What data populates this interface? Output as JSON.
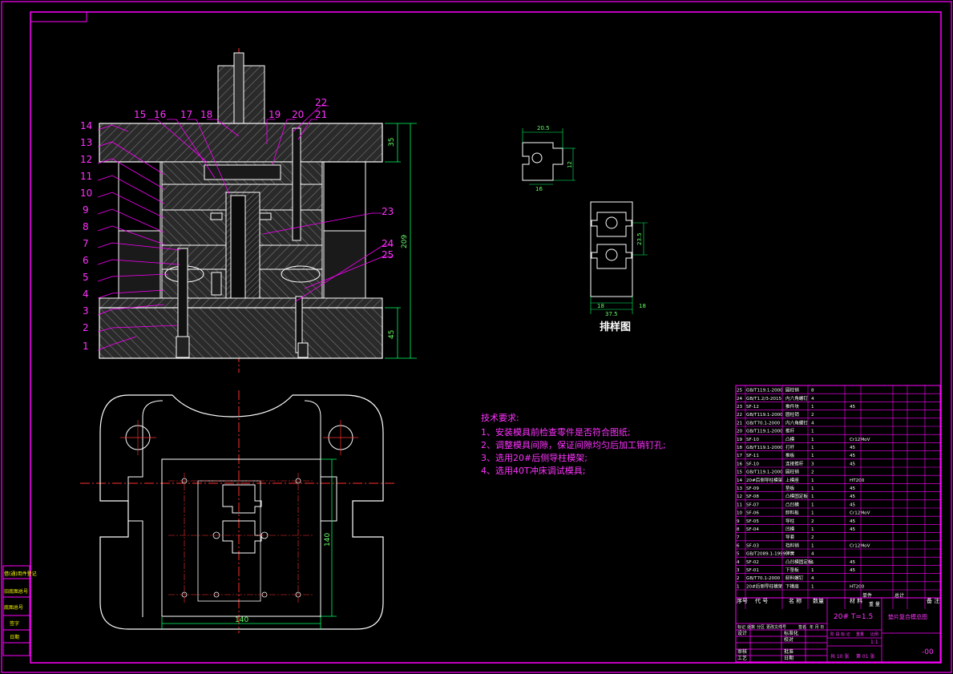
{
  "colors": {
    "border": "#ff00ff",
    "outline": "#ffffff",
    "section_fill": "#3a3a3a",
    "centerline": "#ff3030",
    "leader": "#ff00ff",
    "dimension": "#00ff66",
    "magenta_text": "#ff33ff",
    "dim_text": "#66ff66",
    "yellow": "#ffff00"
  },
  "part_numbers": [
    "1",
    "2",
    "3",
    "4",
    "5",
    "6",
    "7",
    "8",
    "9",
    "10",
    "11",
    "12",
    "13",
    "14",
    "15",
    "16",
    "17",
    "18",
    "19",
    "20",
    "21",
    "22",
    "23",
    "24",
    "25"
  ],
  "front_view": {
    "dimensions": {
      "top_plate": "35",
      "total_height": "209",
      "bottom_plate": "45"
    }
  },
  "top_view": {
    "dimensions": {
      "width": "140",
      "height": "140"
    }
  },
  "blank_layout": {
    "caption": "排样图",
    "dimensions": {
      "pitch": "23.5",
      "strip_width": "37.5",
      "margin_left": "18",
      "margin_right": "18"
    }
  },
  "part_drawing": {
    "dimensions": {
      "top": "20.5",
      "side": "12",
      "bottom": "16"
    }
  },
  "tech_requirements": {
    "title": "技术要求:",
    "items": [
      "1、安装模具前检查零件是否符合图纸;",
      "2、调整模具间隙，保证间隙均匀后加工销钉孔;",
      "3、选用20#后侧导柱模架;",
      "4、选用40T冲床调试模具;"
    ]
  },
  "bom": {
    "header": {
      "seq": "序号",
      "code": "代 号",
      "name": "名 称",
      "qty": "数量",
      "material": "材 料",
      "unit_weight": "单件",
      "total_weight": "总计",
      "weight": "重 量",
      "remark": "备 注"
    },
    "rows": [
      {
        "seq": "25",
        "code": "GB/T119.1-2000",
        "name": "圆柱销",
        "qty": "8",
        "material": ""
      },
      {
        "seq": "24",
        "code": "GB/T1.2/3-2015",
        "name": "内六角螺钉",
        "qty": "4",
        "material": ""
      },
      {
        "seq": "23",
        "code": "SF-12",
        "name": "推件块",
        "qty": "1",
        "material": "45"
      },
      {
        "seq": "22",
        "code": "GB/T119.1-2000",
        "name": "圆柱销",
        "qty": "2",
        "material": ""
      },
      {
        "seq": "21",
        "code": "GB/T70.1-2000",
        "name": "内六角螺钉",
        "qty": "4",
        "material": ""
      },
      {
        "seq": "20",
        "code": "GB/T119.1-2000",
        "name": "推杆",
        "qty": "1",
        "material": ""
      },
      {
        "seq": "19",
        "code": "SF-10",
        "name": "凸模",
        "qty": "1",
        "material": "Cr12MoV"
      },
      {
        "seq": "18",
        "code": "GB/T119.1-2000",
        "name": "打杆",
        "qty": "1",
        "material": "45"
      },
      {
        "seq": "17",
        "code": "SF-11",
        "name": "推板",
        "qty": "1",
        "material": "45"
      },
      {
        "seq": "16",
        "code": "SF-10",
        "name": "连接推杆",
        "qty": "3",
        "material": "45"
      },
      {
        "seq": "15",
        "code": "GB/T119.1-2000",
        "name": "圆柱销",
        "qty": "2",
        "material": ""
      },
      {
        "seq": "14",
        "code": "20#后侧导柱模架",
        "name": "上模座",
        "qty": "1",
        "material": "HT200"
      },
      {
        "seq": "13",
        "code": "SF-09",
        "name": "垫板",
        "qty": "1",
        "material": "45"
      },
      {
        "seq": "12",
        "code": "SF-08",
        "name": "凸模固定板",
        "qty": "1",
        "material": "45"
      },
      {
        "seq": "11",
        "code": "SF-07",
        "name": "凸凹模",
        "qty": "1",
        "material": "45"
      },
      {
        "seq": "10",
        "code": "SF-06",
        "name": "卸料板",
        "qty": "1",
        "material": "Cr12MoV"
      },
      {
        "seq": "9",
        "code": "SF-05",
        "name": "导柱",
        "qty": "2",
        "material": "45"
      },
      {
        "seq": "8",
        "code": "SF-04",
        "name": "凹模",
        "qty": "1",
        "material": "45"
      },
      {
        "seq": "7",
        "code": "",
        "name": "导套",
        "qty": "2",
        "material": ""
      },
      {
        "seq": "6",
        "code": "SF-03",
        "name": "挡料销",
        "qty": "1",
        "material": "Cr12MoV"
      },
      {
        "seq": "5",
        "code": "GB/T2089.1-1999",
        "name": "弹簧",
        "qty": "4",
        "material": ""
      },
      {
        "seq": "4",
        "code": "SF-02",
        "name": "凸凹模固定板",
        "qty": "1",
        "material": "45"
      },
      {
        "seq": "3",
        "code": "SF-01",
        "name": "下垫板",
        "qty": "1",
        "material": "45"
      },
      {
        "seq": "2",
        "code": "GB/T70.1-2000",
        "name": "卸料螺钉",
        "qty": "4",
        "material": ""
      },
      {
        "seq": "1",
        "code": "20#后侧导柱模架",
        "name": "下模座",
        "qty": "1",
        "material": "HT200"
      }
    ]
  },
  "title_block": {
    "material_spec": "20# T=1.5",
    "drawing_name": "垫片复合模总图",
    "drawing_number": "-00",
    "scale": "1:1",
    "sheet_total": "共 10 张",
    "sheet_no": "第 01 张",
    "row_labels": [
      "标记",
      "处数",
      "分区",
      "更改文件号",
      "签名",
      "年 月 日"
    ],
    "roles": {
      "design": "设计",
      "standard": "标准化",
      "review": "审核",
      "process": "工艺",
      "check": "校对",
      "approve": "批准",
      "date": "日期"
    },
    "stage_labels": [
      "阶 段 标 记",
      "重量",
      "比例"
    ]
  },
  "left_strip": {
    "labels": [
      "借(通)用件登记",
      "旧底图总号",
      "底图总号",
      "签字",
      "日期"
    ]
  }
}
